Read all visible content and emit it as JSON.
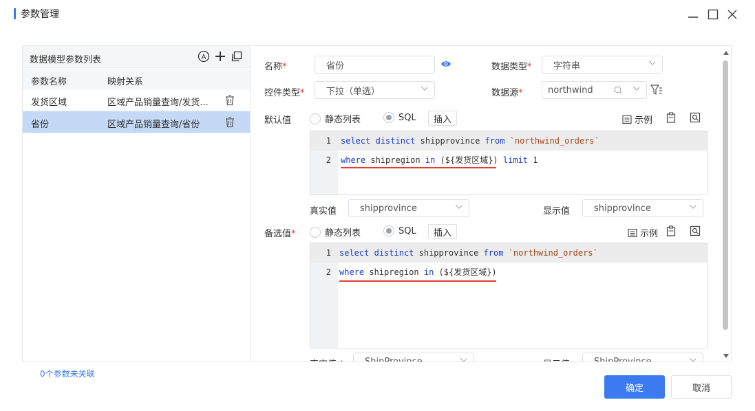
{
  "window": {
    "title": "参数管理"
  },
  "left": {
    "header_title": "数据模型参数列表",
    "col_name": "参数名称",
    "col_mapping": "映射关系",
    "rows": [
      {
        "name": "发货区域",
        "mapping": "区域产品销量查询/发货..."
      },
      {
        "name": "省份",
        "mapping": "区域产品销量查询/省份"
      }
    ],
    "status": "0个参数未关联"
  },
  "form": {
    "name_label": "名称",
    "name_value": "省份",
    "datatype_label": "数据类型",
    "datatype_value": "字符串",
    "control_label": "控件类型",
    "control_value": "下拉（单选）",
    "datasource_label": "数据源",
    "datasource_value": "northwind",
    "default_label": "默认值",
    "candidate_label": "备选值",
    "radio_static": "静态列表",
    "radio_sql": "SQL",
    "insert_btn": "插入",
    "example_btn": "示例",
    "real_label": "真实值",
    "display_label": "显示值",
    "default_real": "shipprovince",
    "default_display": "shipprovince",
    "cand_real": "ShipProvince",
    "cand_display": "ShipProvince"
  },
  "editor1": {
    "line1_num": "1",
    "line2_num": "2",
    "l1_select": "select",
    "l1_distinct": "distinct",
    "l1_field": "shipprovince",
    "l1_from": "from",
    "l1_table": "`northwind_orders`",
    "l2_where": "where",
    "l2_field": "shipregion",
    "l2_in": "in",
    "l2_param": "(${发货区域})",
    "l2_limit": "limit",
    "l2_val": "1"
  },
  "editor2": {
    "line1_num": "1",
    "line2_num": "2",
    "l1_select": "select",
    "l1_distinct": "distinct",
    "l1_field": "shipprovince",
    "l1_from": "from",
    "l1_table": "`northwind_orders`",
    "l2_where": "where",
    "l2_field": "shipregion",
    "l2_in": "in",
    "l2_param": "(${发货区域})"
  },
  "footer": {
    "ok": "确定",
    "cancel": "取消"
  },
  "colors": {
    "accent": "#3b7af0",
    "required": "#e53935",
    "selected_row": "#c3d9f5"
  }
}
